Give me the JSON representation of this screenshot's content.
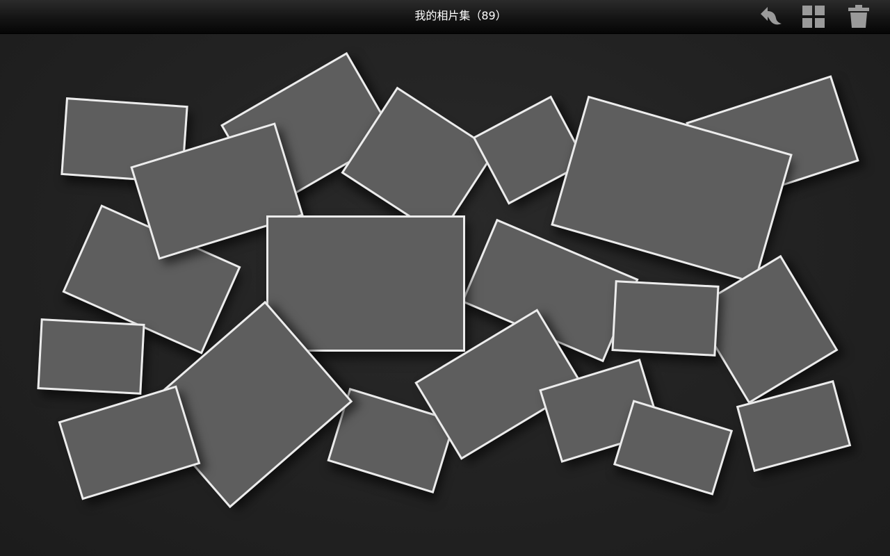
{
  "header": {
    "title": "我的相片集（89）"
  },
  "toolbar": {
    "back_icon": "back-arrow-icon",
    "grid_icon": "grid-view-icon",
    "delete_icon": "trash-icon"
  },
  "colors": {
    "background": "#222222",
    "photo_fill": "#5e5e5e",
    "photo_border": "#ececec",
    "icon": "#9a9a9a"
  }
}
